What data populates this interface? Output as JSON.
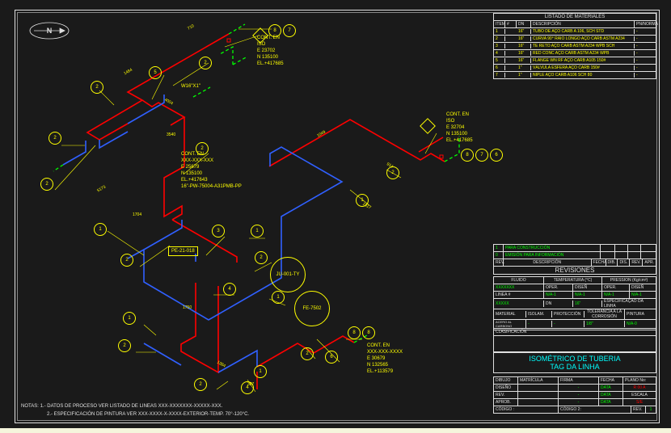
{
  "north_label": "N",
  "bom": {
    "title": "LISTADO DE MATERIALES",
    "headers": [
      "ITEM",
      "#",
      "DN",
      "DESCRIPCIÓN",
      "PN/NORMA"
    ],
    "rows": [
      [
        "1",
        "",
        "16\"",
        "TUBO DE AÇO CARB A 106, SCH STD",
        "-"
      ],
      [
        "2",
        "",
        "16\"",
        "CURVA 90° RAIO LONGO AÇO CARB ASTM A234",
        "-"
      ],
      [
        "3",
        "",
        "16\"",
        "TE RETO AÇO CARB ASTM A234 WPB SCH",
        "-"
      ],
      [
        "4",
        "",
        "16\"",
        "RED CONC AÇO CARB ASTM A234 WPB",
        "-"
      ],
      [
        "5",
        "",
        "16\"",
        "FLANGE WN RF AÇO CARB A105 150#",
        "-"
      ],
      [
        "6",
        "",
        "1\"",
        "VÁLVULA ESFERA AÇO CARB 150#",
        "-"
      ],
      [
        "7",
        "",
        "1\"",
        "NIPLE AÇO CARB A106 SCH 80",
        "-"
      ]
    ]
  },
  "rev_status": {
    "row1": "PARA CONSTRUCCIÓN",
    "row2": "EMISIÓN PARA INFORMACIÓN"
  },
  "rev_hdr": [
    "REV.",
    "DESCRIPCIÓN",
    "FECHA",
    "DIB.",
    "DIS.",
    "REV.",
    "APR."
  ],
  "rev_title": "REVISIONES",
  "spec": {
    "fluido": "FLUIDO",
    "temp": "TEMPERATURA (°C)",
    "pres": "PRESSION (Kg/cm²)",
    "op": "OPER.",
    "dsg": "DISEÑ",
    "linea": "LINEA #",
    "dn": "DN",
    "esp": "ESPECIFICAÇÃO DA LINHA",
    "tol": "TOLERANCIA A LA CORROSIÓN",
    "mat": "MATERIAL",
    "isol": "ISOLAM.",
    "prot": "PROTECCIÓN",
    "pint": "PINTURA",
    "acc": "ACERO AL CARBONO",
    "clas": "CLASIFICACIÓN"
  },
  "title": {
    "line1": "ISOMÉTRICO DE TUBERIA",
    "line2": "TAG DA LINHA"
  },
  "sig": {
    "col1": [
      "DIBUJO",
      "DISEÑO",
      "REV.",
      "APROB."
    ],
    "dash": "-",
    "data": "DATA",
    "plano": "PLANO No:",
    "nrev": "R 00 A",
    "se": "S/E",
    "codigo": "CÓDIGO :",
    "codigo2": "CÓDIGO 2:",
    "rev": "REV.",
    "rev_n": "1"
  },
  "callouts": {
    "c1": {
      "h": "CONT. EN",
      "l1": "ISO",
      "l2": "E 23702",
      "l3": "N 135100",
      "l4": "EL.+417685"
    },
    "c2": {
      "h": "CONT. EN",
      "l1": "ISO",
      "l2": "E 32704",
      "l3": "N 135100",
      "l4": "EL.+417685"
    },
    "c3": {
      "h": "CONT. EN",
      "l1": "XXX-XXX-XXX",
      "l2": "E 25679",
      "l3": "N 135100",
      "l4": "EL.+417643",
      "l5": "16\"-PW-75004-A31PMB-PP"
    },
    "c4": {
      "h": "CONT. EN",
      "l1": "XXX-XXX-XXXX",
      "l2": "E 30679",
      "l3": "N 132565",
      "l4": "EL.+113579"
    },
    "v1": "W16\"X1\"",
    "v2": "PE-21-018",
    "t1": "JU-001-TY",
    "t2": "FE-7502"
  },
  "dims": {
    "d1": "710",
    "d2": "1484",
    "d3": "3540",
    "d4": "4004",
    "d5": "1704",
    "d6": "5173",
    "d7": "1517",
    "d8": "1750",
    "d9": "1384",
    "d10": "387",
    "d11": "914",
    "d12": "1049"
  },
  "notes": {
    "hdr": "NOTAS:",
    "n1": "1.- DATOS DE PROCESO VER LISTADO DE LINEAS XXX-XXXXXXX-XXXXX-XXX.",
    "n2": "2.- ESPECIFICACIÓN DE PINTURA VER XXX-XXXX-X-XXXX-EXTERIOR-TEMP. 70°-120°C."
  }
}
